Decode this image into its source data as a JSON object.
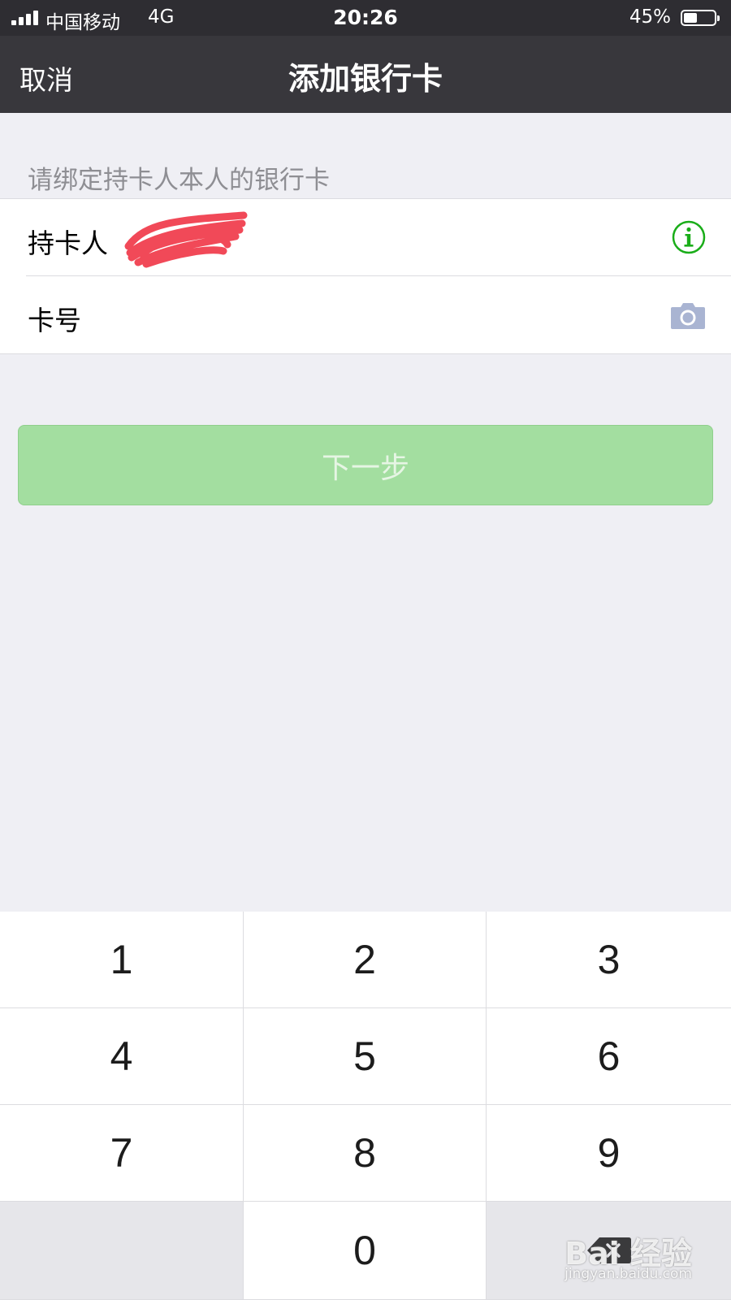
{
  "status_bar": {
    "carrier": "中国移动",
    "network": "4G",
    "time": "20:26",
    "battery_percent": "45%",
    "battery_level": 0.45
  },
  "nav": {
    "cancel_label": "取消",
    "title": "添加银行卡"
  },
  "form": {
    "hint": "请绑定持卡人本人的银行卡",
    "cardholder_label": "持卡人",
    "card_number_label": "卡号",
    "card_number_value": "",
    "info_icon": "info-circle-icon",
    "camera_icon": "camera-icon"
  },
  "next_button_label": "下一步",
  "keypad": {
    "keys": [
      "1",
      "2",
      "3",
      "4",
      "5",
      "6",
      "7",
      "8",
      "9",
      "",
      "0",
      "delete"
    ]
  },
  "watermark": {
    "text": "Bai 经验",
    "sub": "jingyan.baidu.com"
  },
  "colors": {
    "nav_background": "#38373c",
    "page_background": "#efeff4",
    "accent_green": "#1aad19",
    "button_disabled": "#a3dea0",
    "camera_icon": "#a9b4d2",
    "redaction": "#f03a4a"
  }
}
